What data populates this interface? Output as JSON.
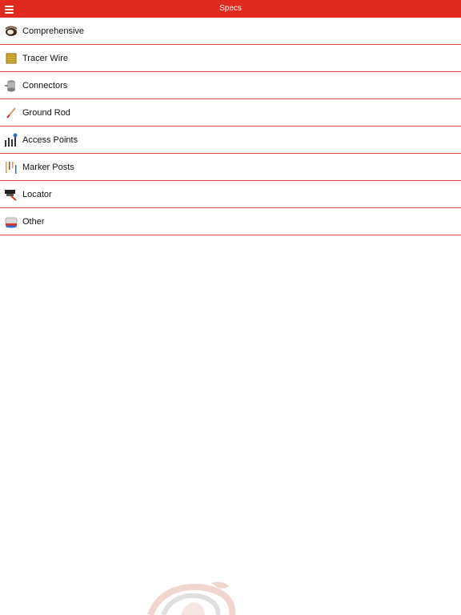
{
  "navbar": {
    "title": "Specs",
    "menu_icon": "hamburger-menu-icon",
    "background": "#e02a1f"
  },
  "list": {
    "divider_color": "#e74a43",
    "items": [
      {
        "label": "Comprehensive",
        "icon": "comprehensive-icon"
      },
      {
        "label": "Tracer Wire",
        "icon": "tracer-wire-icon"
      },
      {
        "label": "Connectors",
        "icon": "connectors-icon"
      },
      {
        "label": "Ground Rod",
        "icon": "ground-rod-icon"
      },
      {
        "label": "Access Points",
        "icon": "access-points-icon"
      },
      {
        "label": "Marker Posts",
        "icon": "marker-posts-icon"
      },
      {
        "label": "Locator",
        "icon": "locator-icon"
      },
      {
        "label": "Other",
        "icon": "other-icon"
      }
    ]
  },
  "watermark": {
    "icon": "snake-logo-icon"
  }
}
